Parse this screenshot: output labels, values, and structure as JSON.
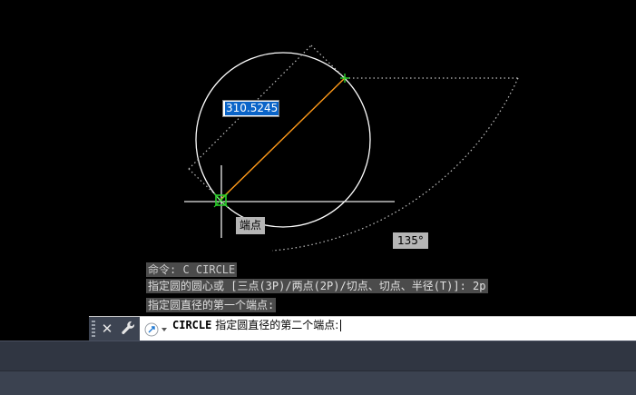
{
  "drawing": {
    "dynamic_input_value": "310.5245",
    "snap_tooltip": "端点",
    "angle_tooltip": "135°"
  },
  "command_history": [
    "命令: C CIRCLE",
    "指定圆的圆心或 [三点(3P)/两点(2P)/切点、切点、半径(T)]: 2p",
    "指定圆直径的第一个端点:"
  ],
  "command_line": {
    "command_name": "CIRCLE",
    "prompt_text": "指定圆直径的第二个端点:"
  },
  "colors": {
    "background": "#000000",
    "circle": "#ffffff",
    "rubber_band": "#ff9a1a",
    "snap_marker": "#2ad02a",
    "tracking_dots": "#bfbfbf",
    "selection": "#0a64c8"
  },
  "icons": {
    "close": "close-icon",
    "customize": "wrench-icon",
    "recent": "recent-commands-icon",
    "grip": "grip-handle-icon"
  }
}
